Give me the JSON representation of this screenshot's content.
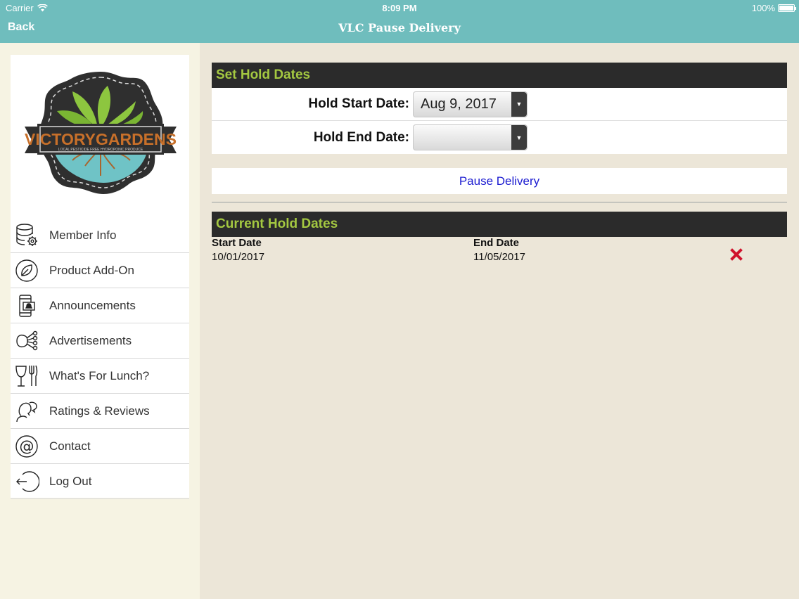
{
  "status_bar": {
    "carrier": "Carrier",
    "time": "8:09 PM",
    "battery": "100%",
    "battery_level": 1.0
  },
  "nav": {
    "back_label": "Back",
    "title": "VLC Pause Delivery"
  },
  "logo": {
    "brand_text": "VICTORYGARDENS",
    "tagline": "LOCAL PESTICIDE FREE HYDROPONIC PRODUCE",
    "colors": {
      "leaf": "#8dc63f",
      "water": "#6fc3c6",
      "badge": "#2f2f2f",
      "text": "#c8702a"
    }
  },
  "sidebar": {
    "items": [
      {
        "label": "Member Info",
        "icon": "database-gear-icon"
      },
      {
        "label": "Product Add-On",
        "icon": "leaf-icon"
      },
      {
        "label": "Announcements",
        "icon": "phone-bell-icon"
      },
      {
        "label": "Advertisements",
        "icon": "network-icon"
      },
      {
        "label": "What's For Lunch?",
        "icon": "fork-glass-icon"
      },
      {
        "label": "Ratings & Reviews",
        "icon": "person-chat-icon"
      },
      {
        "label": "Contact",
        "icon": "at-icon"
      },
      {
        "label": "Log Out",
        "icon": "logout-icon"
      }
    ]
  },
  "set_hold": {
    "heading": "Set Hold Dates",
    "start_label": "Hold Start Date:",
    "start_value": "Aug 9, 2017",
    "end_label": "Hold End Date:",
    "end_value": ""
  },
  "pause_button_label": "Pause Delivery",
  "current_hold": {
    "heading": "Current Hold Dates",
    "columns": {
      "start": "Start Date",
      "end": "End Date"
    },
    "rows": [
      {
        "start": "10/01/2017",
        "end": "11/05/2017"
      }
    ]
  },
  "colors": {
    "nav_bg": "#6fbdbd",
    "header_bg": "#2b2b2b",
    "header_text": "#a4c841",
    "link": "#1a1ad0",
    "delete": "#d0112b"
  }
}
